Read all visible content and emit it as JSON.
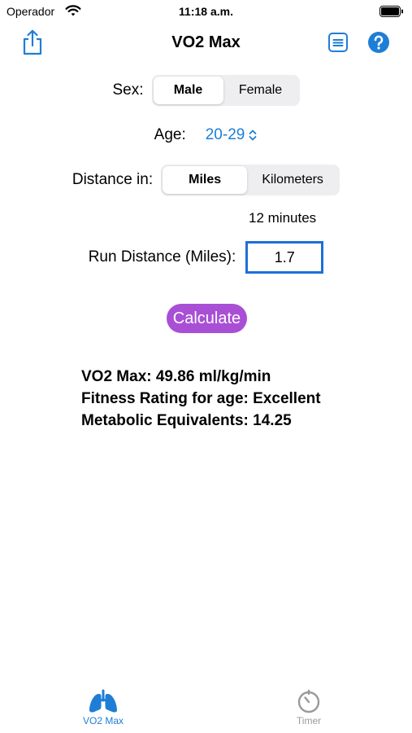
{
  "status": {
    "carrier": "Operador",
    "time": "11:18 a.m."
  },
  "nav": {
    "title": "VO2 Max"
  },
  "sex": {
    "label": "Sex:",
    "options": [
      "Male",
      "Female"
    ],
    "selected": 0
  },
  "age": {
    "label": "Age:",
    "value": "20-29"
  },
  "distance": {
    "label": "Distance in:",
    "options": [
      "Miles",
      "Kilometers"
    ],
    "selected": 0
  },
  "duration": {
    "text": "12 minutes"
  },
  "run": {
    "label": "Run Distance (Miles):",
    "value": "1.7"
  },
  "calculate": {
    "label": "Calculate"
  },
  "results": {
    "vo2": "VO2 Max: 49.86 ml/kg/min",
    "rating": "Fitness Rating for age: Excellent",
    "mets": "Metabolic Equivalents: 14.25"
  },
  "tabs": [
    {
      "label": "VO2 Max",
      "icon": "lungs-icon",
      "active": true
    },
    {
      "label": "Timer",
      "icon": "timer-icon",
      "active": false
    }
  ],
  "colors": {
    "accent": "#1e7ed6",
    "button": "#a94fd6",
    "tab_inactive": "#9a9a9a"
  }
}
